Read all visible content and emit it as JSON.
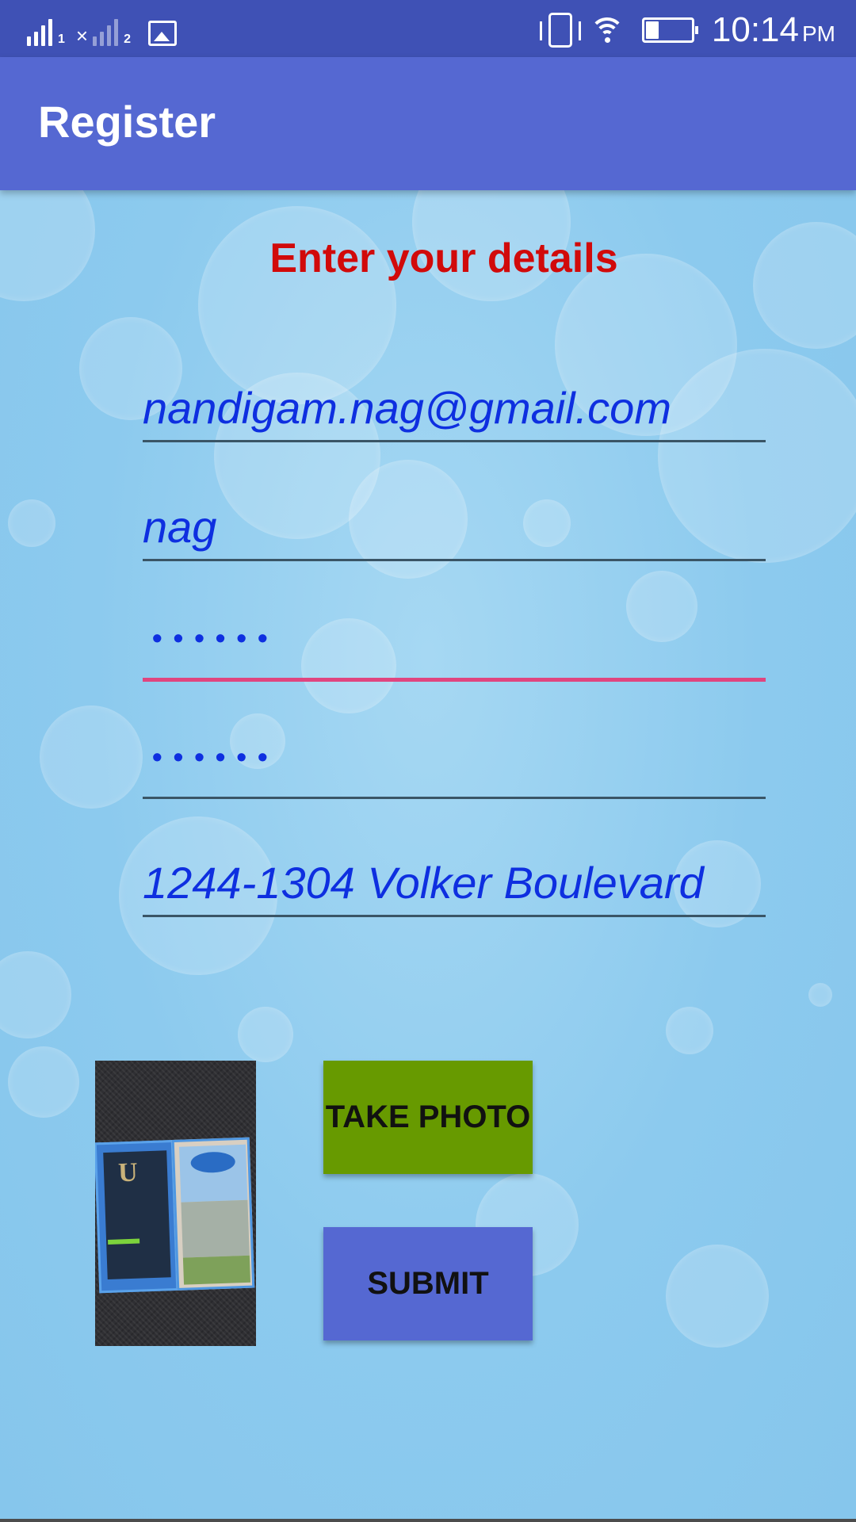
{
  "status_bar": {
    "sim1_index": "1",
    "sim2_index": "2",
    "time": "10:14",
    "ampm": "PM",
    "icons": [
      "signal-sim1-icon",
      "signal-sim2-no-service-icon",
      "image-notification-icon",
      "vibrate-icon",
      "wifi-icon",
      "battery-icon"
    ]
  },
  "app_bar": {
    "title": "Register"
  },
  "form": {
    "heading": "Enter your details",
    "email": "nandigam.nag@gmail.com",
    "name": "nag",
    "password_mask": "••••••",
    "confirm_password_mask": "••••••",
    "address": "1244-1304 Volker Boulevard"
  },
  "buttons": {
    "take_photo": "TAKE PHOTO",
    "submit": "SUBMIT"
  },
  "colors": {
    "status_bar": "#3f51b5",
    "app_bar": "#5568d2",
    "heading": "#d10a0a",
    "field_text": "#0e2fe0",
    "focused_underline": "#e0457f",
    "take_photo_button": "#679a00",
    "submit_button": "#5568d2",
    "background": "#8ccaee"
  }
}
